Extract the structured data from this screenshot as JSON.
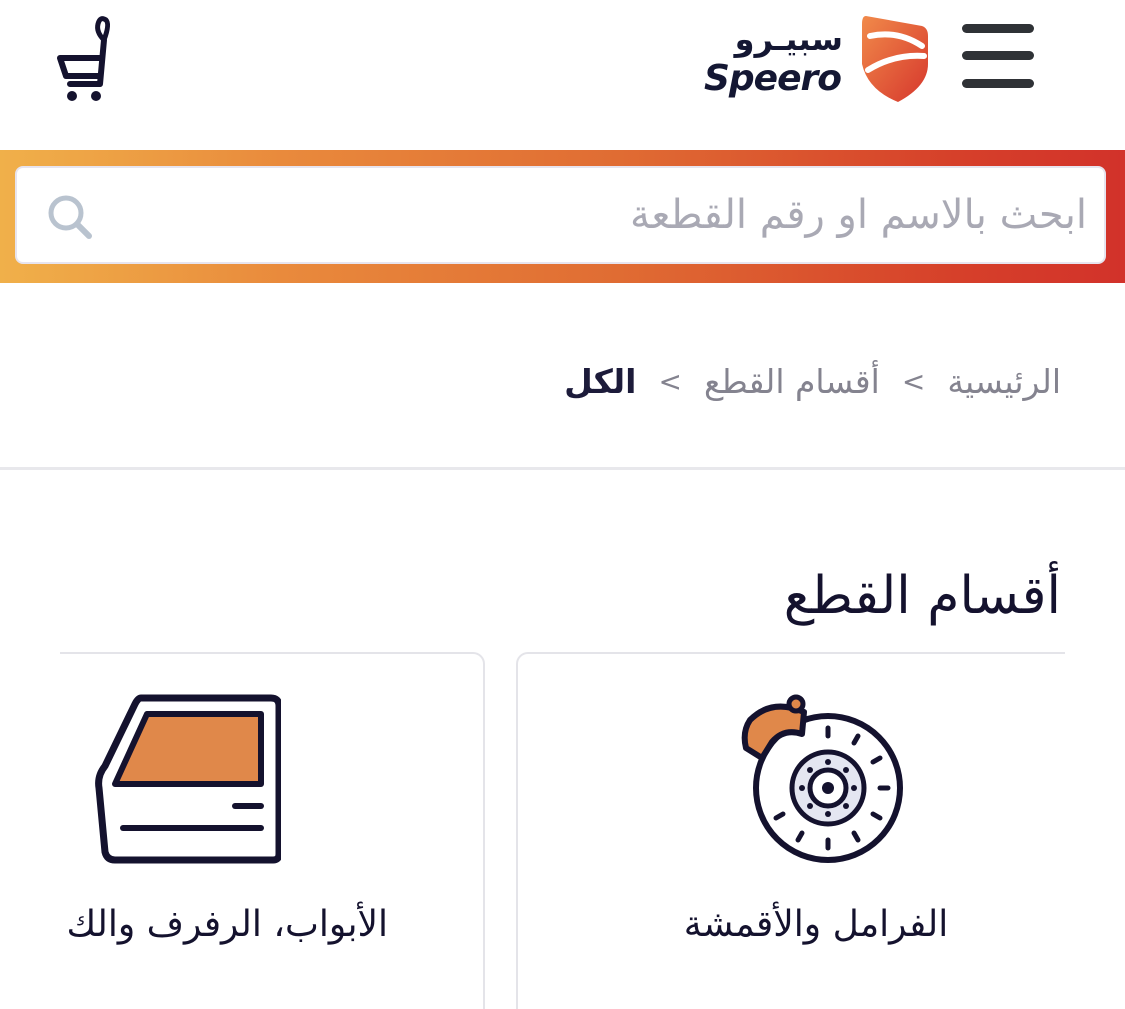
{
  "header": {
    "logo_ar": "سبيـرو",
    "logo_en": "Speero",
    "menu_icon": "hamburger-icon",
    "cart_icon": "cart-icon"
  },
  "search": {
    "placeholder": "ابحث بالاسم او رقم القطعة",
    "icon": "search-icon"
  },
  "breadcrumb": {
    "items": [
      "الرئيسية",
      "أقسام القطع"
    ],
    "current": "الكل",
    "separator": ">"
  },
  "section": {
    "title": "أقسام القطع"
  },
  "categories": [
    {
      "label": "الفرامل والأقمشة",
      "icon": "brake-disc-icon"
    },
    {
      "label": "الأبواب، الرفرف والك",
      "icon": "car-door-icon"
    }
  ],
  "colors": {
    "accent_orange": "#e0884a",
    "brand_red": "#d6402a",
    "brand_yellow": "#f0b04a",
    "text_dark": "#14122e",
    "text_muted": "#84838f"
  }
}
